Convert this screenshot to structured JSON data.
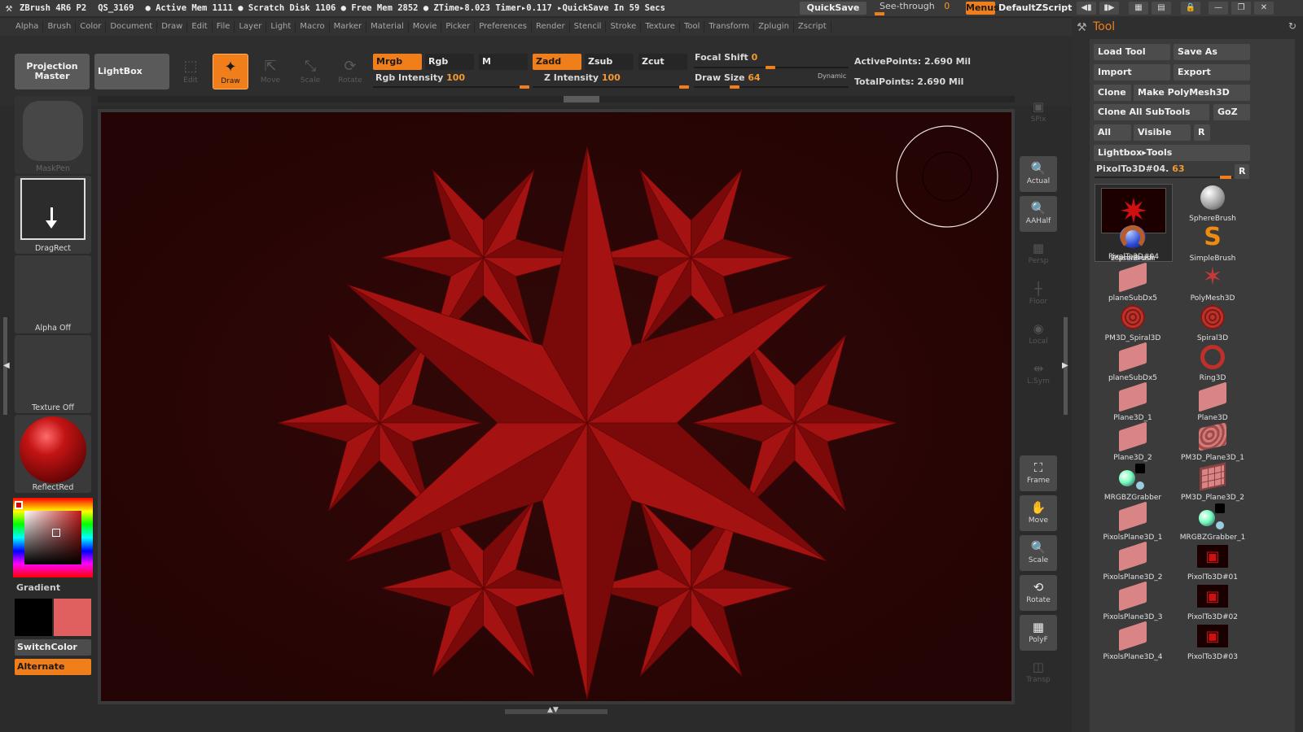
{
  "title_bar": {
    "app": "ZBrush 4R6 P2",
    "doc": "QS_3169",
    "stats": "● Active Mem 1111 ● Scratch Disk 1106 ● Free Mem 2852 ● ZTime▸8.023 Timer▸0.117 ▸QuickSave In 59 Secs",
    "quicksave": "QuickSave",
    "see_through": "See-through",
    "see_through_value": "0",
    "menus": "Menus",
    "script": "DefaultZScript"
  },
  "menu_bar": [
    "Alpha",
    "Brush",
    "Color",
    "Document",
    "Draw",
    "Edit",
    "File",
    "Layer",
    "Light",
    "Macro",
    "Marker",
    "Material",
    "Movie",
    "Picker",
    "Preferences",
    "Render",
    "Stencil",
    "Stroke",
    "Texture",
    "Tool",
    "Transform",
    "Zplugin",
    "Zscript"
  ],
  "toolbar": {
    "projection_master": "Projection Master",
    "lightbox": "LightBox",
    "tools": [
      {
        "label": "Edit",
        "active": false
      },
      {
        "label": "Draw",
        "active": true
      },
      {
        "label": "Move",
        "active": false
      },
      {
        "label": "Scale",
        "active": false
      },
      {
        "label": "Rotate",
        "active": false
      }
    ],
    "mrgb": "Mrgb",
    "rgb": "Rgb",
    "m": "M",
    "zadd": "Zadd",
    "zsub": "Zsub",
    "zcut": "Zcut",
    "rgb_intensity_label": "Rgb Intensity",
    "rgb_intensity": "100",
    "z_intensity_label": "Z Intensity",
    "z_intensity": "100",
    "focal_shift_label": "Focal Shift",
    "focal_shift": "0",
    "draw_size_label": "Draw Size",
    "draw_size": "64",
    "dynamic": "Dynamic",
    "active_points": "ActivePoints: 2.690 Mil",
    "total_points": "TotalPoints: 2.690 Mil"
  },
  "left_shelf": {
    "brush": "MaskPen",
    "stroke": "DragRect",
    "alpha": "Alpha  Off",
    "texture": "Texture  Off",
    "material": "ReflectRed",
    "gradient": "Gradient",
    "switch_color": "SwitchColor",
    "alternate": "Alternate",
    "main_color": "#e06060",
    "secondary_color": "#000000"
  },
  "right_shelf": [
    {
      "label": "SPix",
      "icon": "spix-icon",
      "enabled": false
    },
    {
      "label": "Actual",
      "icon": "actual-icon",
      "enabled": true
    },
    {
      "label": "AAHalf",
      "icon": "aahalf-icon",
      "enabled": true
    },
    {
      "label": "Persp",
      "icon": "persp-icon",
      "enabled": false
    },
    {
      "label": "Floor",
      "icon": "floor-icon",
      "enabled": false
    },
    {
      "label": "Local",
      "icon": "local-icon",
      "enabled": false
    },
    {
      "label": "L.Sym",
      "icon": "lsym-icon",
      "enabled": false
    },
    {
      "label": "Frame",
      "icon": "frame-icon",
      "enabled": true
    },
    {
      "label": "Move",
      "icon": "move-hand-icon",
      "enabled": true
    },
    {
      "label": "Scale",
      "icon": "scale-icon",
      "enabled": true
    },
    {
      "label": "Rotate",
      "icon": "rotate-icon",
      "enabled": true
    },
    {
      "label": "PolyF",
      "icon": "polyf-icon",
      "enabled": true
    },
    {
      "label": "Transp",
      "icon": "transp-icon",
      "enabled": false
    }
  ],
  "tool_panel": {
    "title": "Tool",
    "load_tool": "Load Tool",
    "save_as": "Save As",
    "import": "Import",
    "export": "Export",
    "clone": "Clone",
    "make_polymesh": "Make PolyMesh3D",
    "clone_all": "Clone All SubTools",
    "goz": "GoZ",
    "all": "All",
    "visible": "Visible",
    "r": "R",
    "lightbox_tools": "Lightbox▸Tools",
    "current_tool": "PixolTo3D#04.",
    "current_tool_value": "63",
    "tools": [
      {
        "name": "PixolTo3D#04",
        "icon": "snowflake-thumb-icon"
      },
      {
        "name": "SphereBrush",
        "icon": "sphere-brush-icon"
      },
      {
        "name": "AlphaBrush",
        "icon": "alpha-brush-icon"
      },
      {
        "name": "SimpleBrush",
        "icon": "simple-brush-icon"
      },
      {
        "name": "EraserBrush",
        "icon": "eraser-brush-icon"
      },
      {
        "name": "PolyMesh3D",
        "icon": "star-mesh-icon"
      },
      {
        "name": "planeSubDx5",
        "icon": "plane-icon"
      },
      {
        "name": "Spiral3D",
        "icon": "spiral-icon"
      },
      {
        "name": "PM3D_Spiral3D",
        "icon": "spiral-icon"
      },
      {
        "name": "Ring3D",
        "icon": "ring-icon"
      },
      {
        "name": "planeSubDx5",
        "icon": "plane-icon"
      },
      {
        "name": "Plane3D",
        "icon": "plane-icon"
      },
      {
        "name": "Plane3D_1",
        "icon": "plane-icon"
      },
      {
        "name": "PM3D_Plane3D_1",
        "icon": "plane-textured-icon"
      },
      {
        "name": "Plane3D_2",
        "icon": "plane-icon"
      },
      {
        "name": "PM3D_Plane3D_2",
        "icon": "plane-grid-icon"
      },
      {
        "name": "MRGBZGrabber",
        "icon": "grabber-icon"
      },
      {
        "name": "MRGBZGrabber_1",
        "icon": "grabber-icon"
      },
      {
        "name": "PixolsPlane3D_1",
        "icon": "plane-icon"
      },
      {
        "name": "PixolTo3D#01",
        "icon": "pixol-icon"
      },
      {
        "name": "PixolsPlane3D_2",
        "icon": "plane-icon"
      },
      {
        "name": "PixolTo3D#02",
        "icon": "pixol-icon"
      },
      {
        "name": "PixolsPlane3D_3",
        "icon": "plane-icon"
      },
      {
        "name": "PixolTo3D#03",
        "icon": "pixol-icon"
      },
      {
        "name": "PixolsPlane3D_4",
        "icon": "plane-icon"
      }
    ]
  },
  "colors": {
    "accent": "#f07e1a",
    "model": "#9a0e0e",
    "canvas_bg": "#2a0606"
  }
}
